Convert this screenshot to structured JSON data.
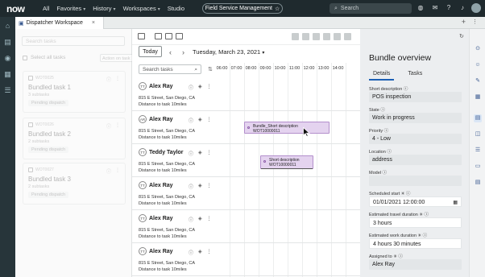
{
  "topbar": {
    "logo": "now",
    "nav": [
      "All",
      "Favorites",
      "History",
      "Workspaces",
      "Studio"
    ],
    "app_name": "Field Service Management",
    "search_placeholder": "Search"
  },
  "tabbar": {
    "active_tab": "Dispatcher Workspace"
  },
  "left_pane": {
    "search_placeholder": "Search tasks",
    "select_all_label": "Select all tasks",
    "dropdown_label": "Action on task",
    "cards": [
      {
        "number": "WOT0025",
        "title": "Bundled task 1",
        "sub": "3 subtasks",
        "badge": "Pending dispatch"
      },
      {
        "number": "WOT0026",
        "title": "Bundled task 2",
        "sub": "2 subtasks",
        "badge": "Pending dispatch"
      },
      {
        "number": "WOT0027",
        "title": "Bundled task 3",
        "sub": "2 subtasks",
        "badge": "Pending dispatch"
      }
    ]
  },
  "schedule": {
    "today_label": "Today",
    "date_label": "Tuesday, March 23, 2021",
    "search_placeholder": "Search tasks",
    "hours": [
      "06:00",
      "07:00",
      "08:00",
      "09:00",
      "10:00",
      "11:00",
      "12:00",
      "13:00",
      "14:00"
    ],
    "rows": [
      {
        "initials": "TT",
        "name": "Alex Ray",
        "address": "815 E Street, San Diego, CA",
        "distance": "Distance to task   10miles"
      },
      {
        "initials": "AR",
        "name": "Alex Ray",
        "address": "815 E Street, San Diego, CA",
        "distance": "Distance to task   10miles"
      },
      {
        "initials": "TT",
        "name": "Teddy Taylor",
        "address": "815 E Street, San Diego, CA",
        "distance": "Distance to task   10miles"
      },
      {
        "initials": "TT",
        "name": "Alex Ray",
        "address": "815 E Street, San Diego, CA",
        "distance": "Distance to task   10miles"
      },
      {
        "initials": "TT",
        "name": "Alex Ray",
        "address": "815 E Street, San Diego, CA",
        "distance": "Distance to task   10miles"
      },
      {
        "initials": "TT",
        "name": "Alex Ray",
        "address": "815 E Street, San Diego, CA",
        "distance": "Distance to task   10miles"
      }
    ],
    "appointments": [
      {
        "line1": "Bundle_Short description",
        "line2": "WOT10000011"
      },
      {
        "line1": "Short description",
        "line2": "WOT10000011"
      }
    ]
  },
  "bundle_panel": {
    "title": "Bundle overview",
    "tabs": [
      "Details",
      "Tasks"
    ],
    "fields": [
      {
        "label": "Short description",
        "value": "POS inspection"
      },
      {
        "label": "State",
        "value": "Work in progress"
      },
      {
        "label": "Priority",
        "value": "4 - Low"
      },
      {
        "label": "Location",
        "value": "address"
      },
      {
        "label": "Model",
        "value": ""
      },
      {
        "label": "Scheduled start",
        "value": "01/01/2021 12:00:00"
      },
      {
        "label": "Estimated travel duration",
        "value": "3 hours"
      },
      {
        "label": "Estimated work duration",
        "value": "4 hours 30 minutes"
      },
      {
        "label": "Assigned to",
        "value": "Alex Ray"
      }
    ]
  },
  "colors": {
    "topbar": "#1f2a2e",
    "appointment_fill": "#e4d3ef",
    "appointment_border": "#b38fcc",
    "accent": "#1c5fb4"
  }
}
